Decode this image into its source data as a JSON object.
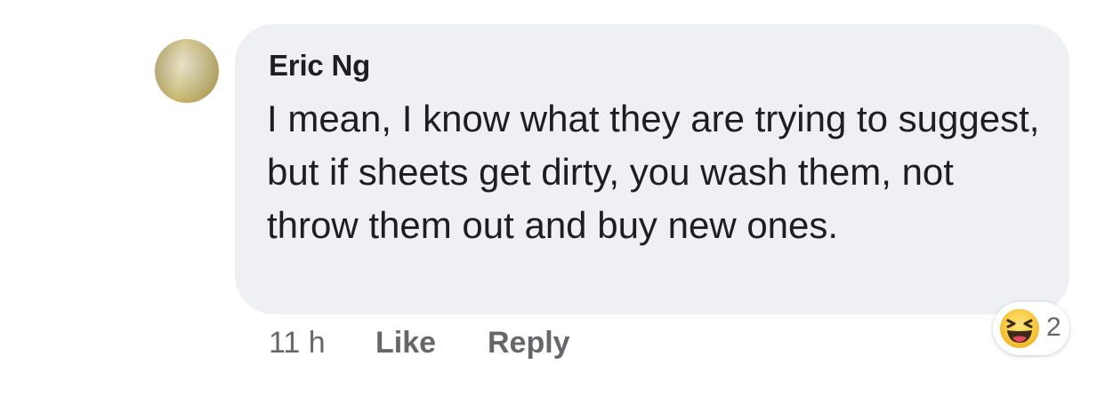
{
  "comment": {
    "author": "Eric Ng",
    "text": "I mean, I know what they are trying to suggest, but if sheets get dirty, you wash them, not throw them out and buy new ones.",
    "timestamp": "11 h",
    "like_label": "Like",
    "reply_label": "Reply",
    "reaction": {
      "icon": "haha-emoji-icon",
      "count": "2"
    }
  },
  "colors": {
    "bubble": "#eff0f4",
    "text": "#1c1e21",
    "meta": "#65676b"
  }
}
